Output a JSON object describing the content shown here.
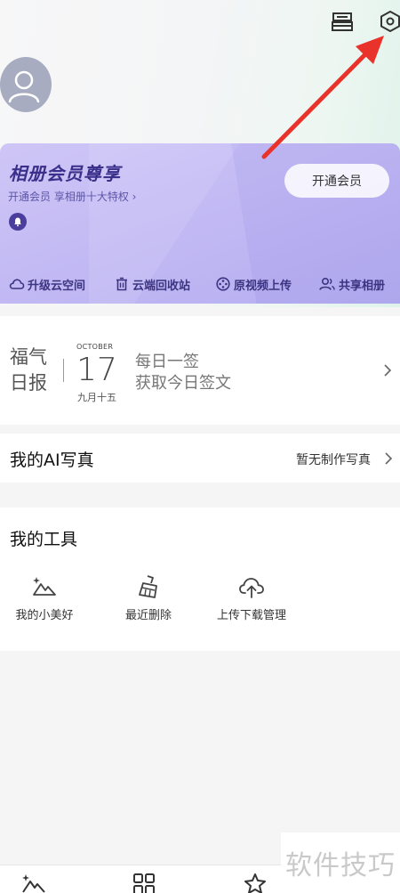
{
  "member": {
    "title": "相册会员尊享",
    "subtitle": "开通会员 享相册十大特权 ›",
    "open_button": "开通会员",
    "perks": [
      "升级云空间",
      "云端回收站",
      "原视频上传",
      "共享相册"
    ]
  },
  "fortune": {
    "title": "福气日报",
    "month": "OCTOBER",
    "day": "17",
    "lunar": "九月十五",
    "line1": "每日一签",
    "line2": "获取今日签文"
  },
  "ai_photo": {
    "title": "我的AI写真",
    "status": "暂无制作写真"
  },
  "tools": {
    "title": "我的工具",
    "items": [
      {
        "label": "我的小美好",
        "icon": "mountain-sparkle-icon"
      },
      {
        "label": "最近删除",
        "icon": "broom-icon"
      },
      {
        "label": "上传下载管理",
        "icon": "cloud-upload-icon"
      }
    ]
  },
  "bottom_nav": [
    "photos-tab-icon",
    "albums-tab-icon",
    "discover-tab-icon"
  ],
  "watermark": "软件技巧",
  "colors": {
    "member_card": "#c3baf4",
    "member_text": "#3a2f8a",
    "annotation_arrow": "#e8322a"
  }
}
